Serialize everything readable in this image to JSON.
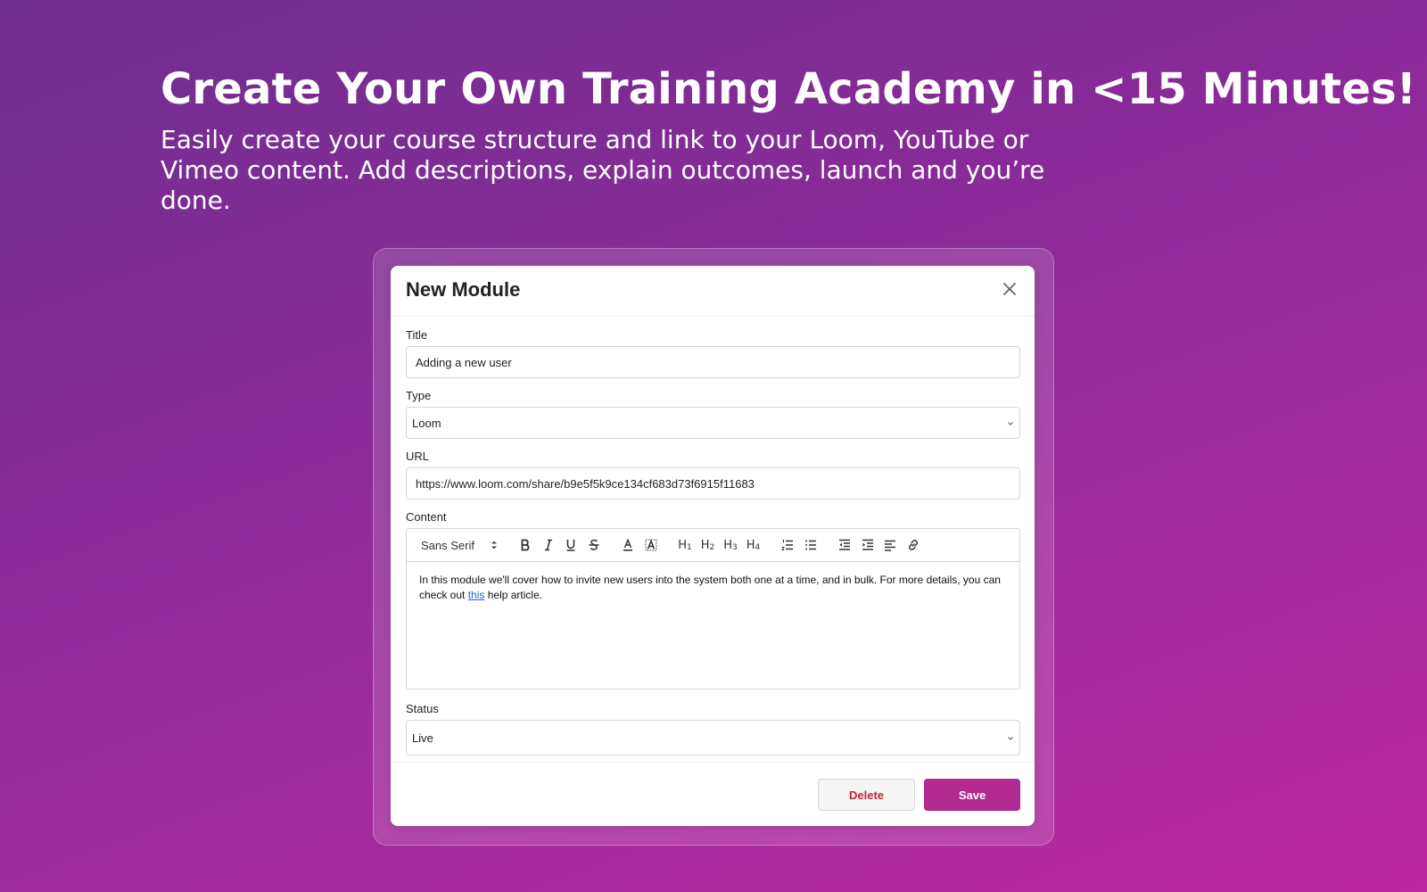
{
  "hero": {
    "title": "Create Your Own Training Academy in <15 Minutes!",
    "subtitle": "Easily create your course structure and link to your Loom, YouTube or Vimeo content. Add descriptions, explain outcomes, launch and you’re done."
  },
  "modal": {
    "title": "New Module",
    "close_icon": "close-icon",
    "fields": {
      "title_label": "Title",
      "title_value": "Adding a new user",
      "type_label": "Type",
      "type_value": "Loom",
      "url_label": "URL",
      "url_value": "https://www.loom.com/share/b9e5f5k9ce134cf683d73f6915f11683",
      "content_label": "Content",
      "status_label": "Status",
      "status_value": "Live"
    },
    "editor": {
      "font": "Sans Serif",
      "toolbar_icons": [
        "bold-icon",
        "italic-icon",
        "underline-icon",
        "strikethrough-icon",
        "text-color-icon",
        "highlight-icon",
        "h1-icon",
        "h2-icon",
        "h3-icon",
        "h4-icon",
        "ordered-list-icon",
        "bullet-list-icon",
        "outdent-icon",
        "indent-icon",
        "align-icon",
        "link-icon"
      ],
      "h1": "H",
      "h1_sub": "1",
      "h2": "H",
      "h2_sub": "2",
      "h3": "H",
      "h3_sub": "3",
      "h4": "H",
      "h4_sub": "4",
      "content_before": "In this module we'll cover how to invite new users into the system both one at a time, and in bulk. For more details, you can check out ",
      "content_link": "this",
      "content_after": " help article."
    },
    "footer": {
      "delete_label": "Delete",
      "save_label": "Save"
    }
  },
  "colors": {
    "accent": "#b02a8f",
    "danger": "#c0272d",
    "link": "#2a62c9"
  }
}
